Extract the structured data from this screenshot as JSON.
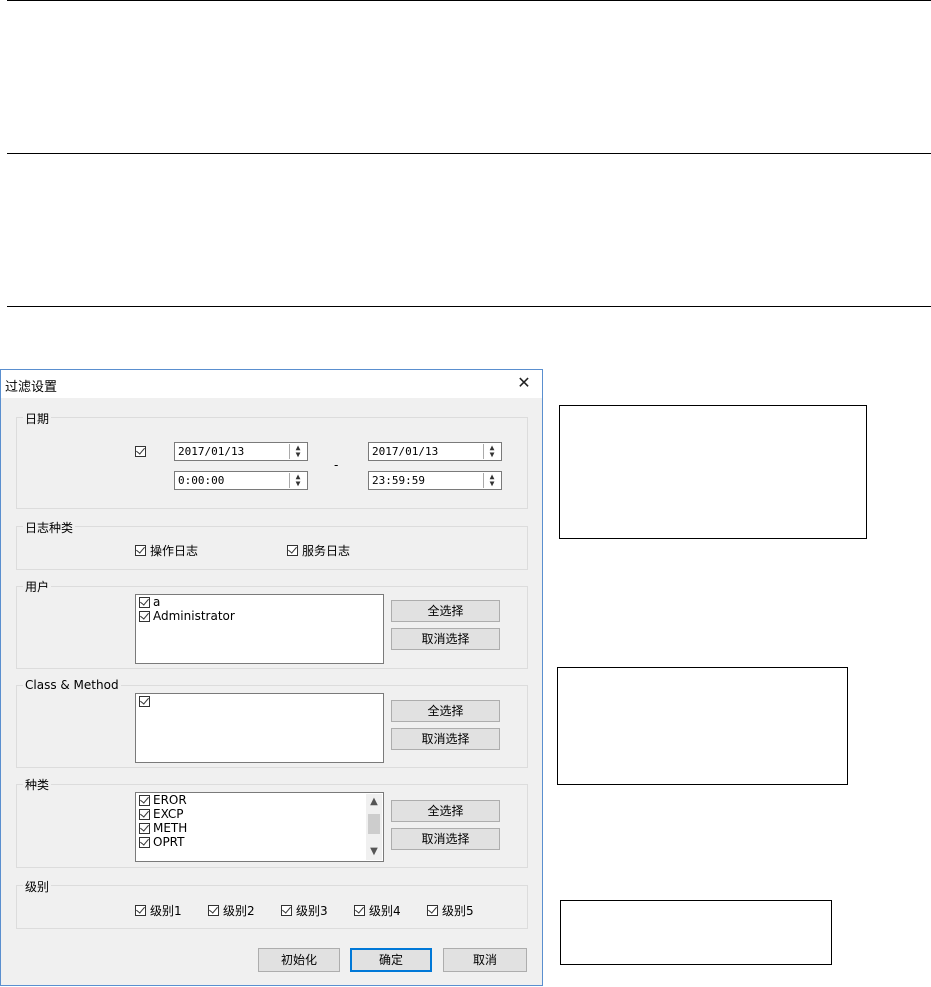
{
  "dialog": {
    "title": "过滤设置",
    "close_glyph": "✕",
    "date_group": {
      "label": "日期",
      "start_date": "2017/01/13",
      "start_time": "0:00:00",
      "separator": "-",
      "end_date": "2017/01/13",
      "end_time": "23:59:59"
    },
    "log_type_group": {
      "label": "日志种类",
      "options": [
        "操作日志",
        "服务日志"
      ]
    },
    "user_group": {
      "label": "用户",
      "items": [
        "a",
        "Administrator"
      ],
      "select_all": "全选择",
      "deselect": "取消选择"
    },
    "class_method_group": {
      "label": "Class & Method",
      "items": [
        ""
      ],
      "select_all": "全选择",
      "deselect": "取消选择"
    },
    "kind_group": {
      "label": "种类",
      "items": [
        "EROR",
        "EXCP",
        "METH",
        "OPRT"
      ],
      "select_all": "全选择",
      "deselect": "取消选择"
    },
    "level_group": {
      "label": "级别",
      "levels": [
        "级别1",
        "级别2",
        "级别3",
        "级别4",
        "级别5"
      ]
    },
    "buttons": {
      "init": "初始化",
      "ok": "确定",
      "cancel": "取消"
    }
  },
  "colors": {
    "dialog_bg": "#f0f0f0",
    "border_accent": "#0078d7"
  }
}
